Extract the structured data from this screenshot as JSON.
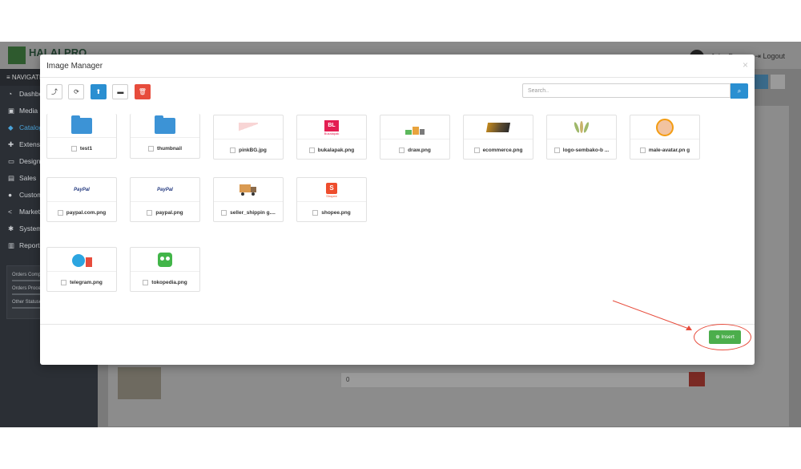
{
  "app": {
    "brand": "HALALPRO",
    "user_name": "John Doe",
    "logout_label": "Logout",
    "nav_title": "NAVIGATION"
  },
  "sidebar": {
    "items": [
      {
        "label": "Dashboard",
        "icon": "dashboard-icon"
      },
      {
        "label": "Media",
        "icon": "image-icon"
      },
      {
        "label": "Catalog",
        "icon": "tag-icon",
        "active": true
      },
      {
        "label": "Extensions",
        "icon": "puzzle-icon"
      },
      {
        "label": "Design",
        "icon": "monitor-icon"
      },
      {
        "label": "Sales",
        "icon": "cart-icon"
      },
      {
        "label": "Customers",
        "icon": "user-icon"
      },
      {
        "label": "Marketing",
        "icon": "share-icon"
      },
      {
        "label": "System",
        "icon": "gear-icon"
      },
      {
        "label": "Reports",
        "icon": "chart-icon"
      }
    ],
    "stats": [
      "Orders Completed",
      "Orders Processing",
      "Other Statuses"
    ]
  },
  "background": {
    "input_value": "0"
  },
  "modal": {
    "title": "Image Manager",
    "close_glyph": "×",
    "search_placeholder": "Search..",
    "toolbar": [
      {
        "name": "parent-button",
        "glyph": "⤴"
      },
      {
        "name": "refresh-button",
        "glyph": "⟳"
      },
      {
        "name": "upload-button",
        "glyph": "⬆"
      },
      {
        "name": "new-folder-button",
        "glyph": "▬"
      },
      {
        "name": "delete-button",
        "glyph": "🗑"
      }
    ],
    "items": [
      {
        "label": "test1",
        "type": "folder"
      },
      {
        "label": "thumbnail",
        "type": "folder"
      },
      {
        "label": "pinkBG.jpg",
        "type": "image"
      },
      {
        "label": "bukalapak.png",
        "type": "image"
      },
      {
        "label": "draw.png",
        "type": "image"
      },
      {
        "label": "ecommerce.png",
        "type": "image"
      },
      {
        "label": "logo-sembako-b ...",
        "type": "image"
      },
      {
        "label": "male-avatar.pn g",
        "type": "image"
      },
      {
        "label": "paypal.com.png",
        "type": "image"
      },
      {
        "label": "paypal.png",
        "type": "image"
      },
      {
        "label": "seller_shippin g....",
        "type": "image"
      },
      {
        "label": "shopee.png",
        "type": "image"
      },
      {
        "label": "telegram.png",
        "type": "image"
      },
      {
        "label": "tokopedia.png",
        "type": "image"
      }
    ],
    "insert_label": "Insert",
    "image_text": {
      "bukalapak": "BL",
      "bukalapak_sub": "Bukalapak",
      "paypal": "PayPal",
      "shopee": "S",
      "shopee_sub": "Shopee"
    }
  },
  "colors": {
    "primary": "#2a8fd1",
    "danger": "#e74c3c",
    "success": "#4cae4c",
    "sidebar": "#2b2f35"
  }
}
